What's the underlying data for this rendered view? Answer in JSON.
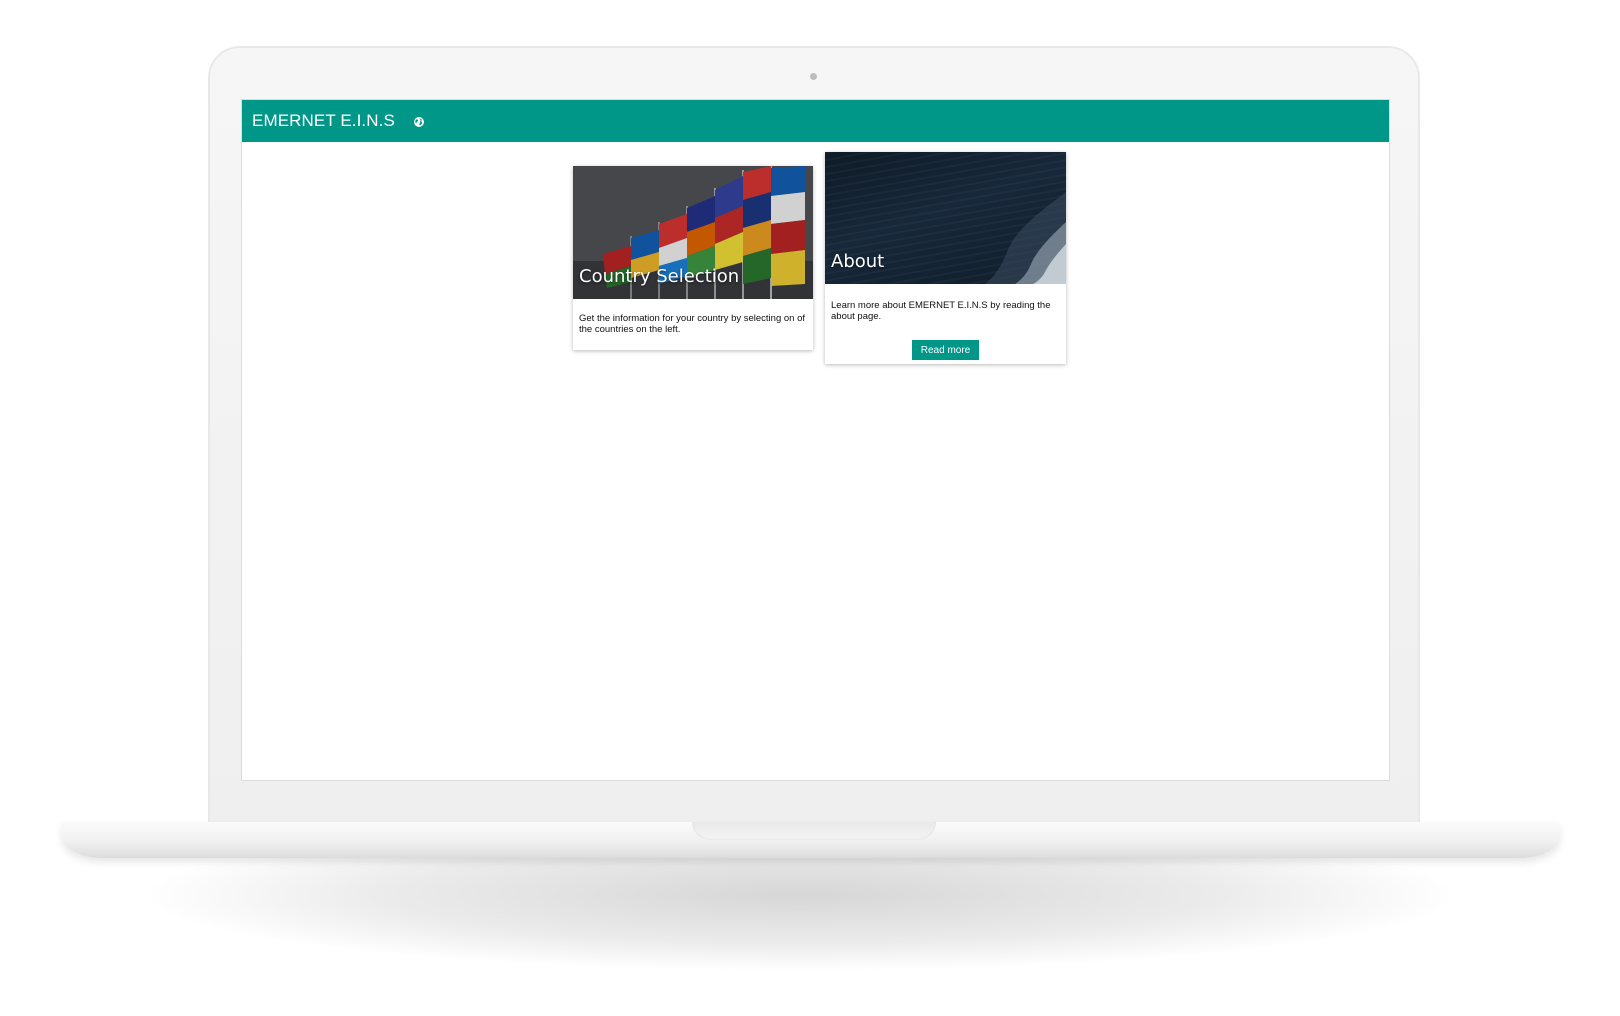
{
  "app": {
    "title": "EMERNET E.I.N.S",
    "header_icon": "globe-icon"
  },
  "colors": {
    "accent": "#009688",
    "card_text": "#111111"
  },
  "cards": [
    {
      "title": "Country Selection",
      "text": "Get the information for your country by selecting on of the countries on the left.",
      "image": "flags-photo"
    },
    {
      "title": "About",
      "text": "Learn more about EMERNET E.I.N.S by reading the about page.",
      "image": "ocean-photo",
      "button_label": "Read more"
    }
  ]
}
